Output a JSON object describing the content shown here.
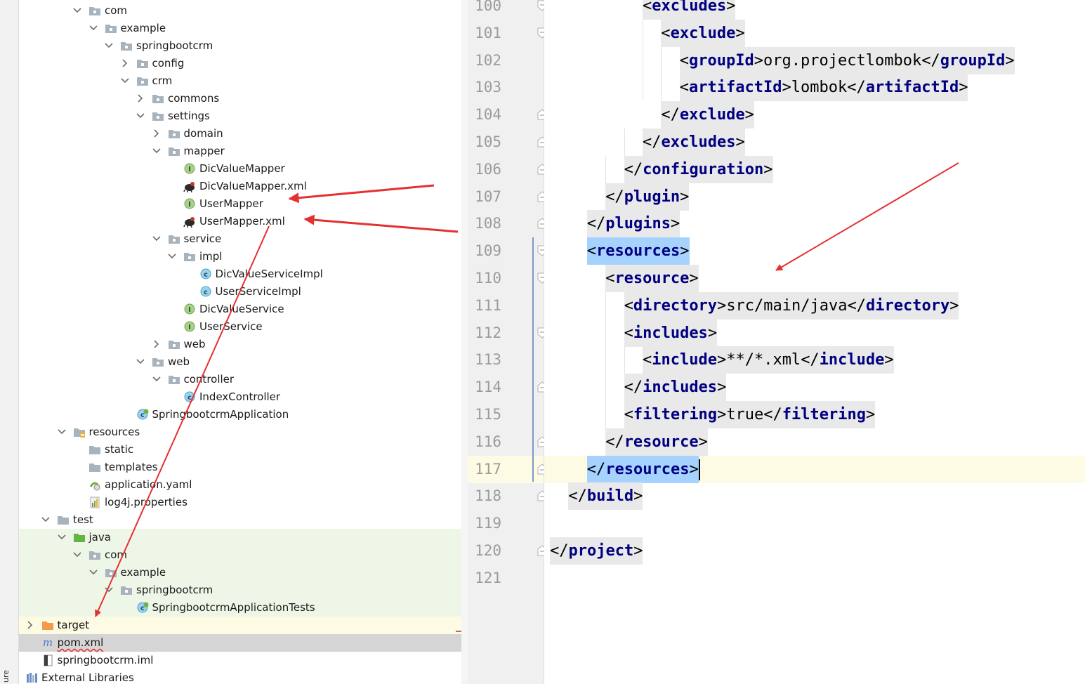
{
  "side_label": "ure",
  "tree": [
    {
      "label": "com",
      "depth": 4,
      "expanded": true,
      "icon": "package-icon"
    },
    {
      "label": "example",
      "depth": 5,
      "expanded": true,
      "icon": "package-icon"
    },
    {
      "label": "springbootcrm",
      "depth": 6,
      "expanded": true,
      "icon": "package-icon"
    },
    {
      "label": "config",
      "depth": 7,
      "expanded": false,
      "icon": "package-icon"
    },
    {
      "label": "crm",
      "depth": 7,
      "expanded": true,
      "icon": "package-icon"
    },
    {
      "label": "commons",
      "depth": 8,
      "expanded": false,
      "icon": "package-icon"
    },
    {
      "label": "settings",
      "depth": 8,
      "expanded": true,
      "icon": "package-icon"
    },
    {
      "label": "domain",
      "depth": 9,
      "expanded": false,
      "icon": "package-icon"
    },
    {
      "label": "mapper",
      "depth": 9,
      "expanded": true,
      "icon": "package-icon"
    },
    {
      "label": "DicValueMapper",
      "depth": 10,
      "icon": "interface-icon"
    },
    {
      "label": "DicValueMapper.xml",
      "depth": 10,
      "icon": "mybatis-icon"
    },
    {
      "label": "UserMapper",
      "depth": 10,
      "icon": "interface-icon"
    },
    {
      "label": "UserMapper.xml",
      "depth": 10,
      "icon": "mybatis-icon"
    },
    {
      "label": "service",
      "depth": 9,
      "expanded": true,
      "icon": "package-icon"
    },
    {
      "label": "impl",
      "depth": 10,
      "expanded": true,
      "icon": "package-icon"
    },
    {
      "label": "DicValueServiceImpl",
      "depth": 11,
      "icon": "class-icon"
    },
    {
      "label": "UserServiceImpl",
      "depth": 11,
      "icon": "class-icon"
    },
    {
      "label": "DicValueService",
      "depth": 10,
      "icon": "interface-icon"
    },
    {
      "label": "UserService",
      "depth": 10,
      "icon": "interface-icon"
    },
    {
      "label": "web",
      "depth": 9,
      "expanded": false,
      "icon": "package-icon"
    },
    {
      "label": "web",
      "depth": 8,
      "expanded": true,
      "icon": "package-icon"
    },
    {
      "label": "controller",
      "depth": 9,
      "expanded": true,
      "icon": "package-icon"
    },
    {
      "label": "IndexController",
      "depth": 10,
      "icon": "class-icon"
    },
    {
      "label": "SpringbootcrmApplication",
      "depth": 7,
      "icon": "springboot-class-icon"
    },
    {
      "label": "resources",
      "depth": 3,
      "expanded": true,
      "icon": "resources-folder-icon"
    },
    {
      "label": "static",
      "depth": 4,
      "icon": "folder-icon"
    },
    {
      "label": "templates",
      "depth": 4,
      "icon": "folder-icon"
    },
    {
      "label": "application.yaml",
      "depth": 4,
      "icon": "yaml-icon"
    },
    {
      "label": "log4j.properties",
      "depth": 4,
      "icon": "properties-icon"
    },
    {
      "label": "test",
      "depth": 2,
      "expanded": true,
      "icon": "folder-icon"
    },
    {
      "label": "java",
      "depth": 3,
      "expanded": true,
      "icon": "test-folder-icon",
      "bg": "green"
    },
    {
      "label": "com",
      "depth": 4,
      "expanded": true,
      "icon": "package-icon",
      "bg": "green"
    },
    {
      "label": "example",
      "depth": 5,
      "expanded": true,
      "icon": "package-icon",
      "bg": "green"
    },
    {
      "label": "springbootcrm",
      "depth": 6,
      "expanded": true,
      "icon": "package-icon",
      "bg": "green"
    },
    {
      "label": "SpringbootcrmApplicationTests",
      "depth": 7,
      "icon": "springboot-class-icon",
      "bg": "green"
    },
    {
      "label": "target",
      "depth": 1,
      "expanded": false,
      "icon": "excluded-folder-icon",
      "bg": "yellow"
    },
    {
      "label": "pom.xml",
      "depth": 1,
      "icon": "maven-icon",
      "bg": "selected",
      "squiggle": true
    },
    {
      "label": "springbootcrm.iml",
      "depth": 1,
      "icon": "iml-icon"
    },
    {
      "label": "External Libraries",
      "depth": 0,
      "expanded": false,
      "icon": "libraries-icon"
    }
  ],
  "editor": {
    "line_numbers": [
      "100",
      "101",
      "102",
      "103",
      "104",
      "105",
      "106",
      "107",
      "108",
      "109",
      "110",
      "111",
      "112",
      "113",
      "114",
      "115",
      "116",
      "117",
      "118",
      "119",
      "120",
      "121"
    ],
    "current_line": "117",
    "lines": [
      {
        "indent": 10,
        "parts": [
          [
            "<",
            "br"
          ],
          [
            "excludes",
            "tag"
          ],
          [
            ">",
            "br"
          ]
        ]
      },
      {
        "indent": 12,
        "parts": [
          [
            "<",
            "br"
          ],
          [
            "exclude",
            "tag"
          ],
          [
            ">",
            "br"
          ]
        ]
      },
      {
        "indent": 14,
        "parts": [
          [
            "<",
            "br"
          ],
          [
            "groupId",
            "tag"
          ],
          [
            ">",
            "br"
          ],
          [
            "org.projectlombok",
            "txt"
          ],
          [
            "</",
            "br"
          ],
          [
            "groupId",
            "tag"
          ],
          [
            ">",
            "br"
          ]
        ]
      },
      {
        "indent": 14,
        "parts": [
          [
            "<",
            "br"
          ],
          [
            "artifactId",
            "tag"
          ],
          [
            ">",
            "br"
          ],
          [
            "lombok",
            "txt"
          ],
          [
            "</",
            "br"
          ],
          [
            "artifactId",
            "tag"
          ],
          [
            ">",
            "br"
          ]
        ]
      },
      {
        "indent": 12,
        "parts": [
          [
            "</",
            "br"
          ],
          [
            "exclude",
            "tag"
          ],
          [
            ">",
            "br"
          ]
        ]
      },
      {
        "indent": 10,
        "parts": [
          [
            "</",
            "br"
          ],
          [
            "excludes",
            "tag"
          ],
          [
            ">",
            "br"
          ]
        ]
      },
      {
        "indent": 8,
        "parts": [
          [
            "</",
            "br"
          ],
          [
            "configuration",
            "tag"
          ],
          [
            ">",
            "br"
          ]
        ]
      },
      {
        "indent": 6,
        "parts": [
          [
            "</",
            "br"
          ],
          [
            "plugin",
            "tag"
          ],
          [
            ">",
            "br"
          ]
        ]
      },
      {
        "indent": 4,
        "parts": [
          [
            "</",
            "br"
          ],
          [
            "plugins",
            "tag"
          ],
          [
            ">",
            "br"
          ]
        ]
      },
      {
        "indent": 4,
        "match": true,
        "parts": [
          [
            "<",
            "br"
          ],
          [
            "resources",
            "tag"
          ],
          [
            ">",
            "br"
          ]
        ]
      },
      {
        "indent": 6,
        "parts": [
          [
            "<",
            "br"
          ],
          [
            "resource",
            "tag"
          ],
          [
            ">",
            "br"
          ]
        ]
      },
      {
        "indent": 8,
        "parts": [
          [
            "<",
            "br"
          ],
          [
            "directory",
            "tag"
          ],
          [
            ">",
            "br"
          ],
          [
            "src/main/java",
            "txt"
          ],
          [
            "</",
            "br"
          ],
          [
            "directory",
            "tag"
          ],
          [
            ">",
            "br"
          ]
        ]
      },
      {
        "indent": 8,
        "parts": [
          [
            "<",
            "br"
          ],
          [
            "includes",
            "tag"
          ],
          [
            ">",
            "br"
          ]
        ]
      },
      {
        "indent": 10,
        "parts": [
          [
            "<",
            "br"
          ],
          [
            "include",
            "tag"
          ],
          [
            ">",
            "br"
          ],
          [
            "**/*.xml",
            "txt"
          ],
          [
            "</",
            "br"
          ],
          [
            "include",
            "tag"
          ],
          [
            ">",
            "br"
          ]
        ]
      },
      {
        "indent": 8,
        "parts": [
          [
            "</",
            "br"
          ],
          [
            "includes",
            "tag"
          ],
          [
            ">",
            "br"
          ]
        ]
      },
      {
        "indent": 8,
        "parts": [
          [
            "<",
            "br"
          ],
          [
            "filtering",
            "tag"
          ],
          [
            ">",
            "br"
          ],
          [
            "true",
            "txt"
          ],
          [
            "</",
            "br"
          ],
          [
            "filtering",
            "tag"
          ],
          [
            ">",
            "br"
          ]
        ]
      },
      {
        "indent": 6,
        "parts": [
          [
            "</",
            "br"
          ],
          [
            "resource",
            "tag"
          ],
          [
            ">",
            "br"
          ]
        ]
      },
      {
        "indent": 4,
        "match": true,
        "caret": true,
        "parts": [
          [
            "</",
            "br"
          ],
          [
            "resources",
            "tag"
          ],
          [
            ">",
            "br"
          ]
        ]
      },
      {
        "indent": 2,
        "parts": [
          [
            "</",
            "br"
          ],
          [
            "build",
            "tag"
          ],
          [
            ">",
            "br"
          ]
        ]
      },
      {
        "indent": 0,
        "parts": []
      },
      {
        "indent": 0,
        "parts": [
          [
            "</",
            "br"
          ],
          [
            "project",
            "tag"
          ],
          [
            ">",
            "br"
          ]
        ]
      },
      {
        "indent": 0,
        "parts": []
      }
    ]
  },
  "colors": {
    "tag": "#000080",
    "match_highlight": "#a6d2ff",
    "annotation_arrow": "#e53030",
    "current_line": "#fdfbe3",
    "test_folder_bg": "#eef7e7"
  }
}
